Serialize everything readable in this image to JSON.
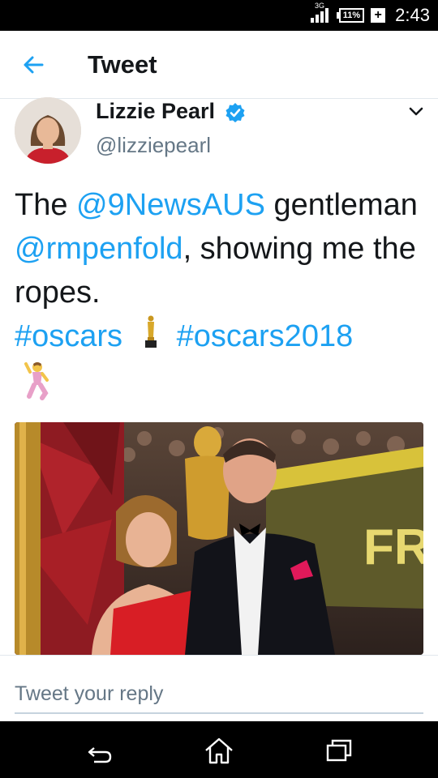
{
  "status_bar": {
    "network": "3G",
    "battery": "11%",
    "time": "2:43"
  },
  "header": {
    "title": "Tweet"
  },
  "tweet": {
    "author_name": "Lizzie Pearl",
    "author_handle": "@lizziepearl",
    "text_parts": {
      "p1": "The ",
      "mention1": "@9NewsAUS",
      "p2": " gentleman ",
      "mention2": "@rmpenfold",
      "p3": ", showing me the ropes. ",
      "hashtag1": "#oscars",
      "hashtag2": "#oscars2018"
    }
  },
  "reply": {
    "placeholder": "Tweet your reply"
  },
  "icons": {
    "back": "arrow-left-icon",
    "verified": "verified-badge-icon",
    "more": "chevron-down-icon",
    "oscar": "oscar-statuette-emoji",
    "dancer": "man-dancing-emoji",
    "nav_back": "back-icon",
    "nav_home": "home-icon",
    "nav_recents": "recents-icon"
  },
  "colors": {
    "link": "#1da1f2",
    "text": "#14171a",
    "secondary": "#657786"
  }
}
